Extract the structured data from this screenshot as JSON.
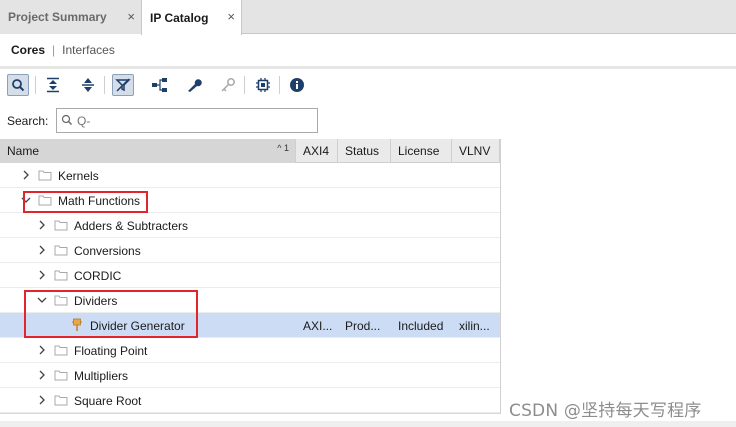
{
  "tabs": [
    {
      "label": "Project Summary",
      "active": false
    },
    {
      "label": "IP Catalog",
      "active": true
    }
  ],
  "subtabs": {
    "cores": "Cores",
    "separator": "|",
    "interfaces": "Interfaces"
  },
  "toolbar": {
    "icons": [
      "search-icon",
      "collapse-all-icon",
      "expand-all-icon",
      "filter-icon",
      "hierarchy-icon",
      "wrench-icon",
      "key-icon",
      "chip-icon",
      "info-icon"
    ]
  },
  "search": {
    "label": "Search:",
    "value": "",
    "placeholder": "Q-"
  },
  "columns": {
    "name": "Name",
    "name_sort": "^ 1",
    "axi4": "AXI4",
    "status": "Status",
    "license": "License",
    "vlnv": "VLNV"
  },
  "tree": [
    {
      "label": "Kernels",
      "expanded": false
    },
    {
      "label": "Math Functions",
      "expanded": true
    },
    {
      "label": "Adders & Subtracters",
      "expanded": false
    },
    {
      "label": "Conversions",
      "expanded": false
    },
    {
      "label": "CORDIC",
      "expanded": false
    },
    {
      "label": "Dividers",
      "expanded": true
    },
    {
      "label": "Divider Generator",
      "axi4": "AXI...",
      "status": "Prod...",
      "license": "Included",
      "vlnv": "xilin...",
      "selected": true
    },
    {
      "label": "Floating Point",
      "expanded": false
    },
    {
      "label": "Multipliers",
      "expanded": false
    },
    {
      "label": "Square Root",
      "expanded": false
    }
  ],
  "close_glyph": "×",
  "watermark": "CSDN @坚持每天写程序",
  "colors": {
    "highlight": "#e0262b",
    "selection": "#cddcf5"
  }
}
